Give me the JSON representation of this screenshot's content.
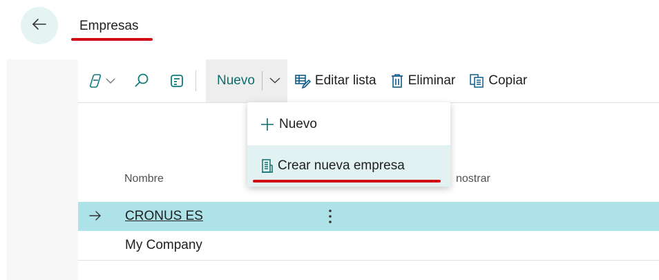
{
  "header": {
    "back_icon": "arrow-left-icon",
    "title": "Empresas"
  },
  "toolbar": {
    "copilot_icon": "copilot-icon",
    "search_icon": "search-icon",
    "view_icon": "view-layout-icon",
    "new_label": "Nuevo",
    "edit_list_label": "Editar lista",
    "delete_label": "Eliminar",
    "copy_label": "Copiar"
  },
  "dropdown": {
    "items": [
      {
        "label": "Nuevo",
        "icon": "plus-icon"
      },
      {
        "label": "Crear nueva empresa",
        "icon": "building-icon"
      }
    ]
  },
  "table": {
    "columns": [
      "Nombre",
      "nostrar"
    ],
    "rows": [
      {
        "name": "CRONUS ES",
        "selected": true
      },
      {
        "name": "My Company",
        "selected": false
      }
    ]
  },
  "colors": {
    "accent": "#0f6c6c",
    "selected_row": "#ade3e8",
    "highlight": "#d10c12"
  }
}
